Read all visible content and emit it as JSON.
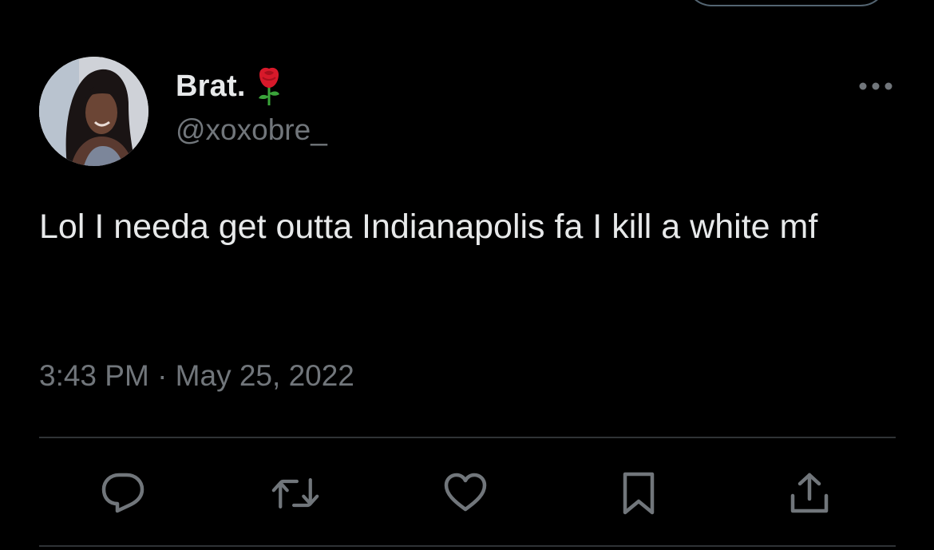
{
  "tweet": {
    "author": {
      "display_name": "Brat.",
      "handle": "@xoxobre_"
    },
    "text": "Lol I needa get outta Indianapolis fa I kill a white mf",
    "timestamp": "3:43 PM · May 25, 2022"
  },
  "icons": {
    "name_emoji": "rose-icon",
    "more": "more-icon",
    "reply": "reply-icon",
    "retweet": "retweet-icon",
    "like": "heart-icon",
    "bookmark": "bookmark-icon",
    "share": "share-icon"
  },
  "colors": {
    "background": "#000000",
    "primary_text": "#e7e9ea",
    "secondary_text": "#71767b",
    "divider": "#2f3336",
    "icon": "#71767b"
  }
}
